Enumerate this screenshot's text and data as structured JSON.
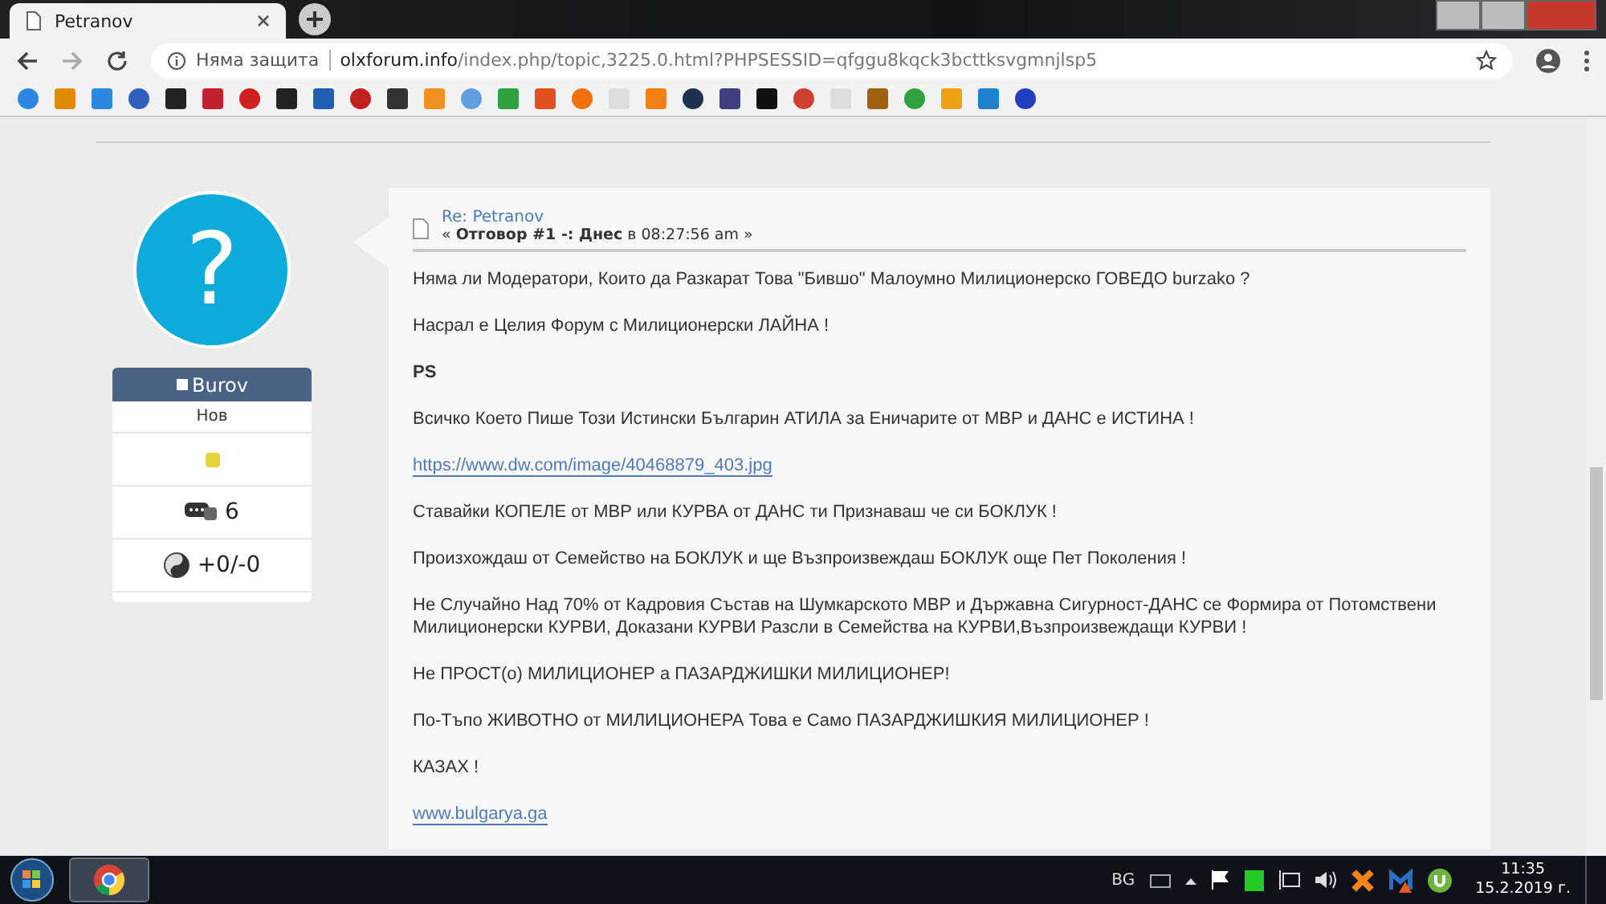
{
  "browser": {
    "tab": {
      "title": "Petranov"
    },
    "address": {
      "security": "Няма защита",
      "domain": "olxforum.info",
      "path": "/index.php/topic,3225.0.html?PHPSESSID=qfggu8kqck3bcttksvgmnjlsp5"
    }
  },
  "profile": {
    "avatar_glyph": "?",
    "name": "Burov",
    "rank": "Нов",
    "posts": "6",
    "karma": "+0/-0"
  },
  "post": {
    "title": "Re: Petranov",
    "meta": "« **Отговор #1 -: Днес** в 08:27:56 am »",
    "paragraphs": [
      {
        "kind": "text",
        "text": "Няма ли Модератори, Които да Разкарат Това \"Бившо\" Малоумно Милиционерско ГОВЕДО burzako ?"
      },
      {
        "kind": "text",
        "text": "Насрал е Целия Форум с Милиционерски ЛАЙНА !"
      },
      {
        "kind": "bold",
        "text": "PS"
      },
      {
        "kind": "text",
        "text": "Всичко Което Пише Този Истински Българин АТИЛА за Еничарите от МВР и ДАНС е ИСТИНА !"
      },
      {
        "kind": "link",
        "text": "https://www.dw.com/image/40468879_403.jpg"
      },
      {
        "kind": "text",
        "text": "Ставайки КОПЕЛЕ от МВР или КУРВА от ДАНС ти Признаваш че си БОКЛУК !"
      },
      {
        "kind": "text",
        "text": "Произхождаш от Семейство на БОКЛУК и ще Възпроизвеждаш БОКЛУК още Пет Поколения !"
      },
      {
        "kind": "text",
        "text": "Не Случайно Над 70% от Кадровия Състав на Шумкарското МВР и Държавна Сигурност-ДАНС се Формира от Потомствени Милиционерски КУРВИ, Доказани КУРВИ Разсли в Семейства на КУРВИ,Възпроизвеждащи КУРВИ !"
      },
      {
        "kind": "text",
        "text": "Не ПРОСТ(о) МИЛИЦИОНЕР а ПАЗАРДЖИШКИ МИЛИЦИОНЕР!"
      },
      {
        "kind": "text",
        "text": "По-Тъпо ЖИВОТНО от МИЛИЦИОНЕРА Това е Само ПАЗАРДЖИШКИЯ МИЛИЦИОНЕР !"
      },
      {
        "kind": "text",
        "text": "КАЗАХ !"
      },
      {
        "kind": "link",
        "text": "www.bulgarya.ga"
      }
    ]
  },
  "taskbar": {
    "language": "BG",
    "time": "11:35",
    "date": "15.2.2019 г."
  }
}
